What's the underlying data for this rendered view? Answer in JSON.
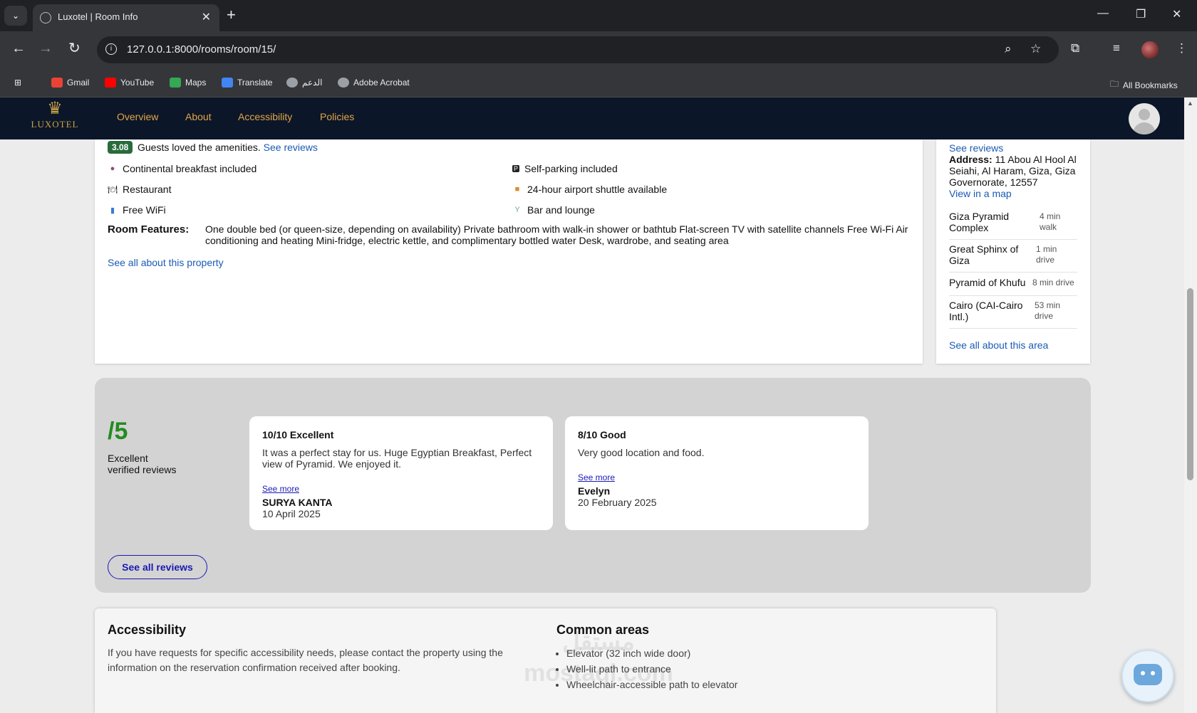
{
  "browser": {
    "tab_title": "Luxotel | Room Info",
    "url": "127.0.0.1:8000/rooms/room/15/",
    "bookmarks": [
      "Gmail",
      "YouTube",
      "Maps",
      "Translate",
      "الدعم",
      "Adobe Acrobat"
    ],
    "all_bookmarks": "All Bookmarks"
  },
  "site": {
    "logo_text": "LUXOTEL",
    "nav": [
      "Overview",
      "About",
      "Accessibility",
      "Policies"
    ]
  },
  "amenities": {
    "rating": "3.08",
    "rating_text": "Guests loved the amenities.",
    "see_reviews": "See reviews",
    "items": [
      {
        "icon": "breakfast-icon",
        "label": "Continental breakfast included"
      },
      {
        "icon": "parking-icon",
        "label": "Self-parking included"
      },
      {
        "icon": "restaurant-icon",
        "label": "Restaurant"
      },
      {
        "icon": "shuttle-icon",
        "label": "24-hour airport shuttle available"
      },
      {
        "icon": "wifi-icon",
        "label": "Free WiFi"
      },
      {
        "icon": "cocktail-icon",
        "label": "Bar and lounge"
      }
    ],
    "room_features_label": "Room Features:",
    "room_features_text": "One double bed (or queen-size, depending on availability) Private bathroom with walk-in shower or bathtub Flat-screen TV with satellite channels Free Wi-Fi Air conditioning and heating Mini-fridge, electric kettle, and complimentary bottled water Desk, wardrobe, and seating area",
    "see_all_property": "See all about this property"
  },
  "location": {
    "see_reviews": "See reviews",
    "address_label": "Address:",
    "address": "11 Abou Al Hool Al Seiahi, Al Haram, Giza, Giza Governorate, 12557",
    "view_map": "View in a map",
    "nearby": [
      {
        "name": "Giza Pyramid Complex",
        "time": "4 min walk"
      },
      {
        "name": "Great Sphinx of Giza",
        "time": "1 min drive"
      },
      {
        "name": "Pyramid of Khufu",
        "time": "8 min drive"
      },
      {
        "name": "Cairo (CAI-Cairo Intl.)",
        "time": "53 min drive"
      }
    ],
    "see_all_area": "See all about this area"
  },
  "reviews": {
    "score": "/5",
    "score_label_1": "Excellent",
    "score_label_2": "verified reviews",
    "items": [
      {
        "title": "10/10 Excellent",
        "text": "It was a perfect stay for us. Huge Egyptian Breakfast, Perfect view of Pyramid. We enjoyed it.",
        "more": "See more",
        "author": "SURYA KANTA",
        "date": "10 April 2025"
      },
      {
        "title": "8/10 Good",
        "text": "Very good location and food.",
        "more": "See more",
        "author": "Evelyn",
        "date": "20 February 2025"
      }
    ],
    "see_all": "See all reviews"
  },
  "accessibility": {
    "title": "Accessibility",
    "text": "If you have requests for specific accessibility needs, please contact the property using the information on the reservation confirmation received after booking.",
    "common_title": "Common areas",
    "common_items": [
      "Elevator (32 inch wide door)",
      "Well-lit path to entrance",
      "Wheelchair-accessible path to elevator"
    ]
  },
  "watermark": "مستقل\nmostaql.com"
}
